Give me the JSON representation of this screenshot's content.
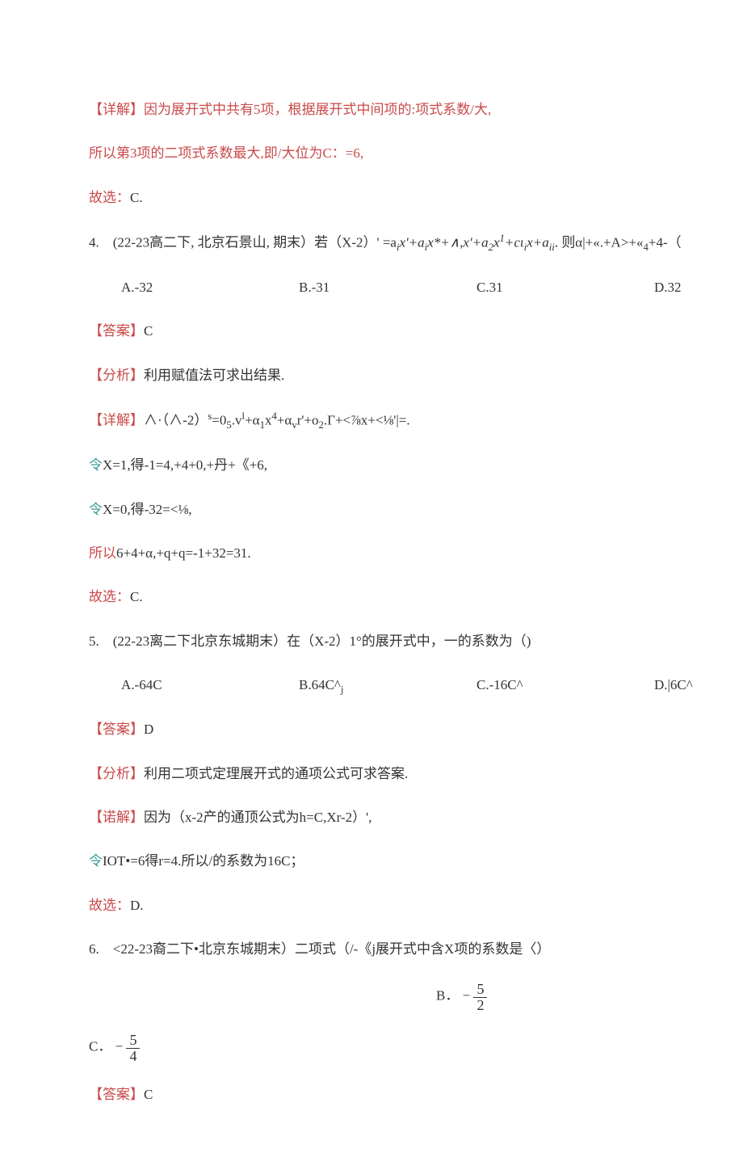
{
  "q3": {
    "detail_label": "【详解】",
    "detail_text": "因为展开式中共有5项，根据展开式中间项的:项式系数/大,",
    "line2": "所以第3项的二项式系数最大,即/大位为C：=6,",
    "choose_label": "故选：",
    "choose_value": "C."
  },
  "q4": {
    "stem_prefix": "4.　(22-23高二下, 北京石景山, 期末）若（X-2）",
    "stem_exp": "' =a",
    "stem_rest": "x'+a",
    "stem_rest2": "x*+∧,x'+a",
    "stem_rest3": "x",
    "stem_rest4": "+cι",
    "stem_rest5": "x+a",
    "stem_tail": ". 则α|+«.+A>+«",
    "stem_tail2": "+4-（",
    "opts": {
      "A": "A.-32",
      "B": "B.-31",
      "C": "C.31",
      "D": "D.32"
    },
    "ans_label": "【答案】",
    "ans_value": "C",
    "ana_label": "【分析】",
    "ana_text": "利用赋值法可求出结果.",
    "det_label": "【详解】",
    "det_text": "∧·（∧-2）",
    "det_text_sup": "s",
    "det_text2": "=0",
    "det_text3": ".v",
    "det_text4": "+α",
    "det_text5": "x",
    "det_text6": "+α",
    "det_text7": "r'+o",
    "det_text8": ".Γ+<⅞x+<⅛'|=.",
    "sub1_pre": "令",
    "sub1": "X=1,得-1=4,+4+0,+丹+《+6,",
    "sub2_pre": "令",
    "sub2": "X=0,得-32=<⅛,",
    "so_pre": "所以",
    "so": "6+4+α,+q+q=-1+32=31.",
    "choose_label": "故选：",
    "choose_value": "C."
  },
  "q5": {
    "stem": "5.　(22-23离二下北京东城期末）在（X-2）1°的展开式中，一的系数为（)",
    "opts": {
      "A": "A.-64C",
      "B": "B.64C^",
      "Bsub": "j",
      "C": "C.-16C^",
      "D": "D.|6C^"
    },
    "ans_label": "【答案】",
    "ans_value": "D",
    "ana_label": "【分析】",
    "ana_text": "利用二项式定理展开式的通项公式可求答案.",
    "det_label": "【诺解】",
    "det_text": "因为（x-2产的通顶公式为h=C,Xr-2）',",
    "sub_pre": "令",
    "sub": "IOT•=6得r=4.所以/的系数为16C；",
    "choose_label": "故选：",
    "choose_value": "D."
  },
  "q6": {
    "stem": "6.　<22-23裔二下•北京东城期末）二项式（/-《j展开式中含X项的系数是〈）",
    "optB_prefix": "B．",
    "optB_neg": "−",
    "optB_num": "5",
    "optB_den": "2",
    "optC_prefix": "C．",
    "optC_neg": "−",
    "optC_num": "5",
    "optC_den": "4",
    "ans_label": "【答案】",
    "ans_value": "C"
  }
}
